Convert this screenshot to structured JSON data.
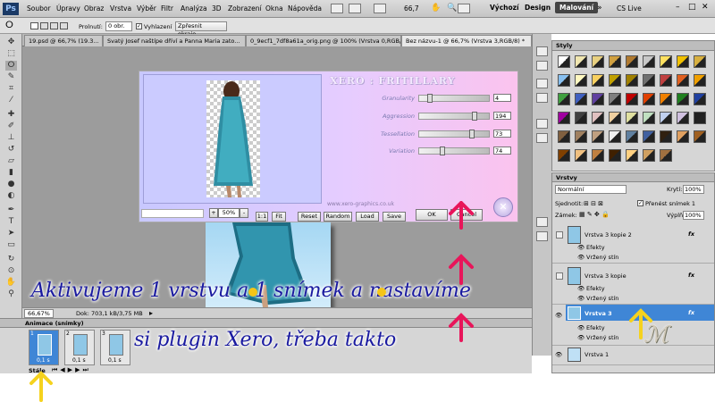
{
  "menu": {
    "logo": "Ps",
    "items": [
      "Soubor",
      "Úpravy",
      "Obraz",
      "Vrstva",
      "Výběr",
      "Filtr",
      "Analýza",
      "3D",
      "Zobrazení",
      "Okna",
      "Nápověda"
    ],
    "zoom": "66,7",
    "workspaces": [
      "Výchozí",
      "Design",
      "Malování"
    ],
    "cslive": "CS Live"
  },
  "options": {
    "prolnuti_label": "Prolnutí:",
    "prolnuti_value": "0 obr.",
    "vyhlazeni_label": "Vyhlazení",
    "refine_button": "Zpřesnit okraje..."
  },
  "tabs": [
    "19.psd @ 66,7% (19.3...",
    "Svatý Josef naštípe dříví a Panna Maria zato...",
    "0_9ecf1_7df8a61a_orig.png @ 100% (Vrstva 0,RGB/...",
    "Bez názvu-1 @ 66,7% (Vrstva 3,RGB/8) *"
  ],
  "plugin": {
    "title": "XERO : FRITILLARY",
    "sliders": [
      {
        "label": "Granularity",
        "value": "4",
        "pos": 0.15
      },
      {
        "label": "Aggression",
        "value": "194",
        "pos": 0.75
      },
      {
        "label": "Tessellation",
        "value": "73",
        "pos": 0.72
      },
      {
        "label": "Variation",
        "value": "74",
        "pos": 0.3
      }
    ],
    "website": "www.xero-graphics.co.uk",
    "zoom_value": "50%",
    "plus": "+",
    "minus": "-",
    "btn_1to1": "1:1",
    "btn_fit": "Fit",
    "btn_reset": "Reset",
    "btn_random": "Random",
    "btn_load": "Load",
    "btn_save": "Save",
    "btn_ok": "OK",
    "btn_cancel": "Cancel"
  },
  "status": {
    "zoom": "66,67%",
    "doc": "Dok: 703,1 kB/3,75 MB"
  },
  "styles_panel": {
    "title": "Styly",
    "swatches": [
      "#ffffff",
      "#f0e6b0",
      "#e8d080",
      "#d0a040",
      "#b07a30",
      "#c8c8c8",
      "#ffe060",
      "#f0c000",
      "#d8b040",
      "#88c0f0",
      "#fff8c0",
      "#f8d060",
      "#c0a000",
      "#a08000",
      "#707070",
      "#c04040",
      "#e06020",
      "#f0a000",
      "#40a040",
      "#4060c0",
      "#6040a0",
      "#808080",
      "#c00000",
      "#e04000",
      "#f08000",
      "#208020",
      "#2040a0",
      "#a000a0",
      "#404040",
      "#e0c0c0",
      "#f0d0a0",
      "#e0e0a0",
      "#c0e0c0",
      "#c0d0f0",
      "#d0c0e0",
      "#202020",
      "#806040",
      "#a08060",
      "#c0a080",
      "#f0f0f0",
      "#6080a0",
      "#4060a0",
      "#302010",
      "#e0a060",
      "#a06020",
      "#804000",
      "#f0c080",
      "#c08040",
      "#402000",
      "#ffd080",
      "#d0a060",
      "#a07040"
    ]
  },
  "layers_panel": {
    "title": "Vrstvy",
    "blend_mode": "Normální",
    "opacity_label": "Krytí:",
    "opacity_value": "100%",
    "lock_label": "Sjednotit:",
    "propagate_label": "Přenést snímek 1",
    "zamek_label": "Zámek:",
    "fill_label": "Výplň:",
    "fill_value": "100%",
    "layers": [
      {
        "name": "Vrstva 3 kopie 2",
        "fx": "fx",
        "effects": "Efekty",
        "shadow": "Vržený stín",
        "selected": false
      },
      {
        "name": "Vrstva 3 kopie",
        "fx": "fx",
        "effects": "Efekty",
        "shadow": "Vržený stín",
        "selected": false
      },
      {
        "name": "Vrstva 3",
        "fx": "fx",
        "effects": "Efekty",
        "shadow": "Vržený stín",
        "selected": true
      },
      {
        "name": "Vrstva 1",
        "fx": "",
        "effects": "",
        "shadow": "",
        "selected": false
      }
    ]
  },
  "animation": {
    "title": "Animace (snímky)",
    "frames": [
      {
        "num": "1",
        "time": "0,1 s"
      },
      {
        "num": "2",
        "time": "0,1 s"
      },
      {
        "num": "3",
        "time": "0,1 s"
      }
    ],
    "loop": "Stále"
  },
  "annotation": {
    "line1": "Aktivujeme 1 vrstvu a 1 snímek a nastavíme",
    "line2": "si plugin Xero, třeba takto"
  },
  "colors": {
    "arrow_red": "#e8155a",
    "arrow_yellow": "#f5d21e",
    "caption": "#1a1aa0",
    "selection_blue": "#3f86d6"
  }
}
